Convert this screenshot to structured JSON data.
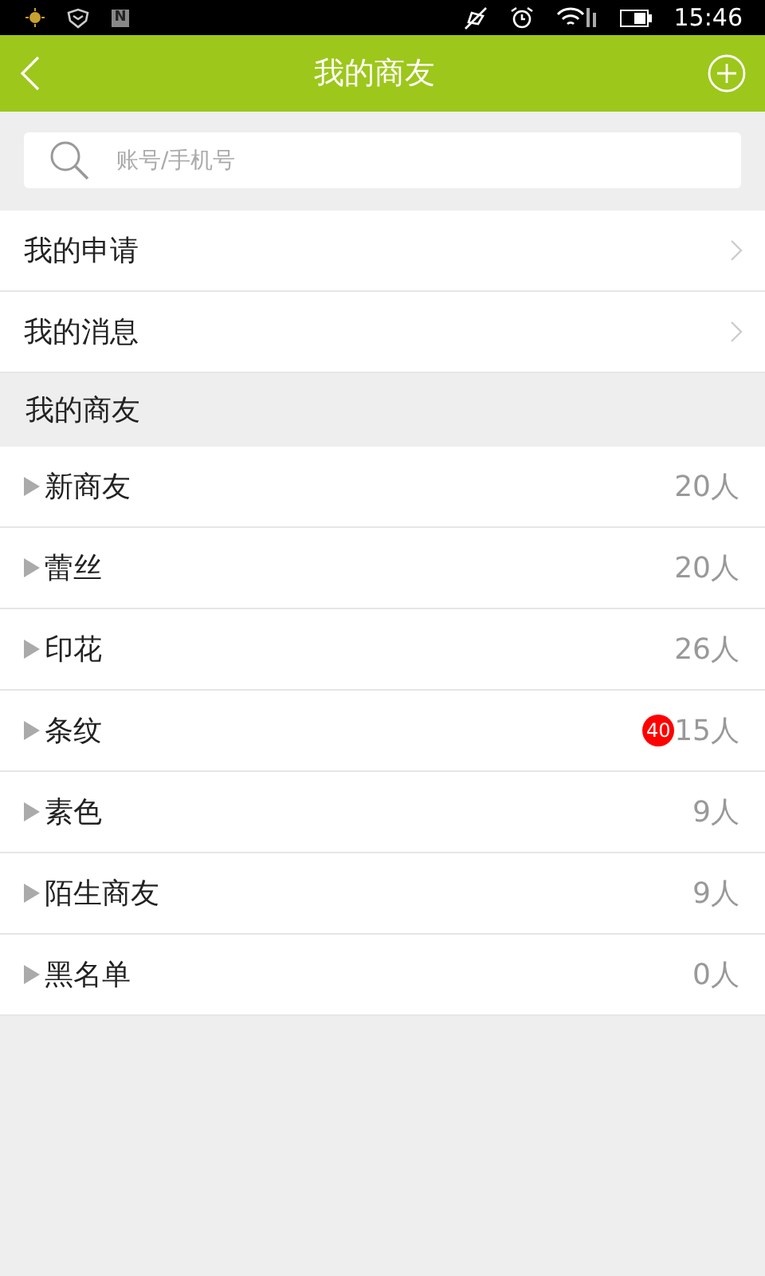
{
  "status_bar": {
    "notification_letter": "N",
    "time": "15:46"
  },
  "header": {
    "title": "我的商友"
  },
  "search": {
    "placeholder": "账号/手机号"
  },
  "menu": [
    {
      "label": "我的申请"
    },
    {
      "label": "我的消息"
    }
  ],
  "section": {
    "title": "我的商友"
  },
  "groups": [
    {
      "name": "新商友",
      "count": "20人",
      "expanded": false
    },
    {
      "name": "蕾丝",
      "count": "20人",
      "expanded": false
    },
    {
      "name": "印花",
      "count": "26人",
      "expanded": false
    },
    {
      "name": "条纹",
      "count": "15人",
      "expanded": false,
      "badge": "40"
    },
    {
      "name": "素色",
      "count": "9人",
      "expanded": false
    },
    {
      "name": "陌生商友",
      "count": "9人",
      "expanded": false
    },
    {
      "name": "黑名单",
      "count": "0人",
      "expanded": false
    }
  ]
}
